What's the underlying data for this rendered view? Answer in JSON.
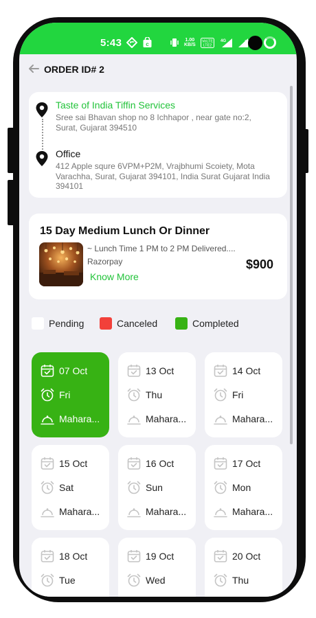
{
  "status_bar": {
    "time": "5:43",
    "net_speed_top": "1.00",
    "net_speed_bottom": "KB/S",
    "volte_top": "VoLTE",
    "volte_bottom": "LTE2",
    "battery": "7"
  },
  "header": {
    "title": "ORDER ID# 2"
  },
  "addresses": {
    "restaurant_name": "Taste of India Tiffin Services",
    "restaurant_address": "Sree sai Bhavan shop no 8 Ichhapor , near gate no:2, Surat, Gujarat 394510",
    "office_name": "Office",
    "office_address": "412 Apple squre 6VPM+P2M, Vrajbhumi Scoiety, Mota Varachha, Surat, Gujarat 394101, India Surat Gujarat India 394101"
  },
  "plan": {
    "title": "15 Day Medium Lunch Or Dinner",
    "description": "~ Lunch Time 1 PM to 2 PM Delivered....",
    "payment": "Razorpay",
    "know_more": "Know More",
    "price": "$900"
  },
  "legend": [
    {
      "label": "Pending",
      "color": "#ffffff"
    },
    {
      "label": "Canceled",
      "color": "#f2403a"
    },
    {
      "label": "Completed",
      "color": "#37b214"
    }
  ],
  "days": [
    {
      "date": "07 Oct",
      "weekday": "Fri",
      "meal": "Mahara...",
      "status": "completed"
    },
    {
      "date": "13 Oct",
      "weekday": "Thu",
      "meal": "Mahara...",
      "status": "pending"
    },
    {
      "date": "14 Oct",
      "weekday": "Fri",
      "meal": "Mahara...",
      "status": "pending"
    },
    {
      "date": "15 Oct",
      "weekday": "Sat",
      "meal": "Mahara...",
      "status": "pending"
    },
    {
      "date": "16 Oct",
      "weekday": "Sun",
      "meal": "Mahara...",
      "status": "pending"
    },
    {
      "date": "17 Oct",
      "weekday": "Mon",
      "meal": "Mahara...",
      "status": "pending"
    },
    {
      "date": "18 Oct",
      "weekday": "Tue",
      "meal": "",
      "status": "pending"
    },
    {
      "date": "19 Oct",
      "weekday": "Wed",
      "meal": "",
      "status": "pending"
    },
    {
      "date": "20 Oct",
      "weekday": "Thu",
      "meal": "",
      "status": "pending"
    }
  ],
  "colors": {
    "accent_green": "#22c33a",
    "status_bar_green": "#22d63f",
    "completed_green": "#37b214",
    "canceled_red": "#f2403a"
  },
  "icons": [
    "back-arrow-icon",
    "location-pin-icon",
    "calendar-check-icon",
    "alarm-clock-icon",
    "food-cloche-icon"
  ]
}
